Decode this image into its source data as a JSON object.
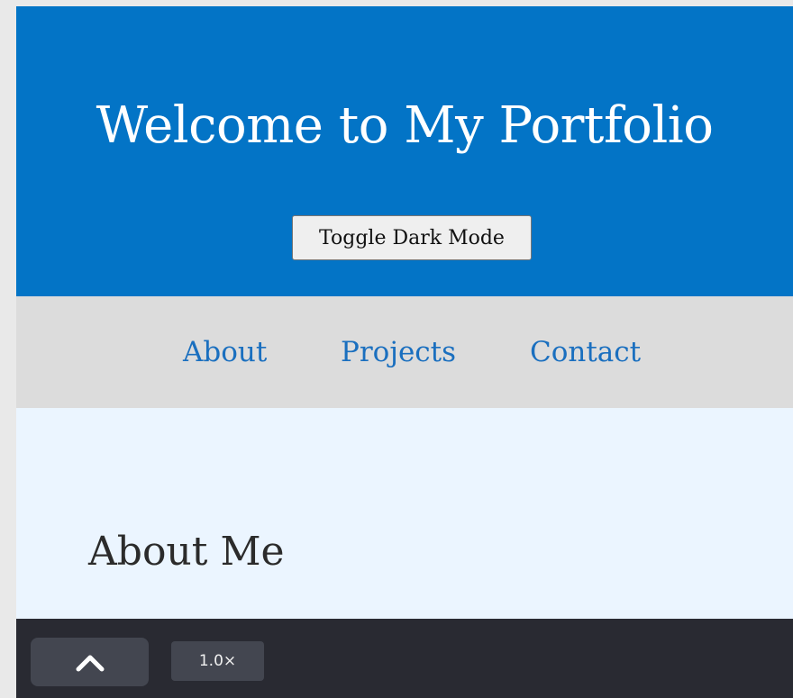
{
  "hero": {
    "title": "Welcome to My Portfolio",
    "toggle_label": "Toggle Dark Mode"
  },
  "nav": {
    "items": [
      {
        "label": "About"
      },
      {
        "label": "Projects"
      },
      {
        "label": "Contact"
      }
    ]
  },
  "about": {
    "heading": "About Me"
  },
  "player": {
    "scroll_icon": "chevron-up-icon",
    "speed_label": "1.0×"
  },
  "colors": {
    "hero_bg": "#0374c6",
    "nav_bg": "#dcdcdc",
    "link": "#1a6fbf",
    "section_bg": "#ebf5ff",
    "bar_bg": "#292a32"
  }
}
